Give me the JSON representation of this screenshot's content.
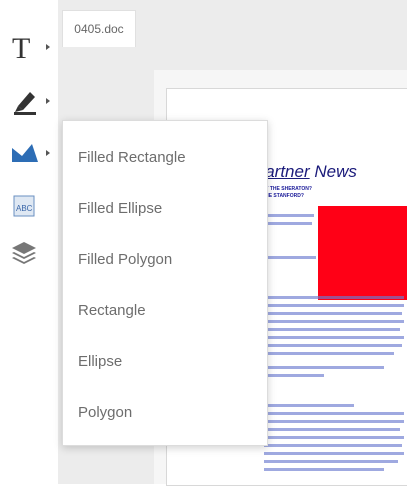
{
  "document": {
    "tab_label": "0405.doc",
    "title": "SecurePartner News",
    "title_underlined": "SecurePartner",
    "title_rest": " News",
    "subtitle_line1": "ARE YOU JOINING US AT THE SHERATON?",
    "subtitle_line2": "...OR MAYBE THE STANFORD?"
  },
  "toolbar": {
    "tools": [
      {
        "name": "text-tool",
        "icon": "text-T-icon"
      },
      {
        "name": "pen-tool",
        "icon": "marker-icon"
      },
      {
        "name": "shape-tool",
        "icon": "shape-icon",
        "color": "#2d6db5"
      },
      {
        "name": "stamp-tool",
        "icon": "stamp-icon"
      },
      {
        "name": "layers-tool",
        "icon": "layers-icon"
      }
    ]
  },
  "shape_menu": {
    "items": [
      {
        "label": "Filled Rectangle"
      },
      {
        "label": "Filled Ellipse"
      },
      {
        "label": "Filled Polygon"
      },
      {
        "label": "Rectangle"
      },
      {
        "label": "Ellipse"
      },
      {
        "label": "Polygon"
      }
    ]
  },
  "colors": {
    "accent": "#2d6db5",
    "red_shape": "#ff0016",
    "doc_text": "#1a1a7a"
  }
}
